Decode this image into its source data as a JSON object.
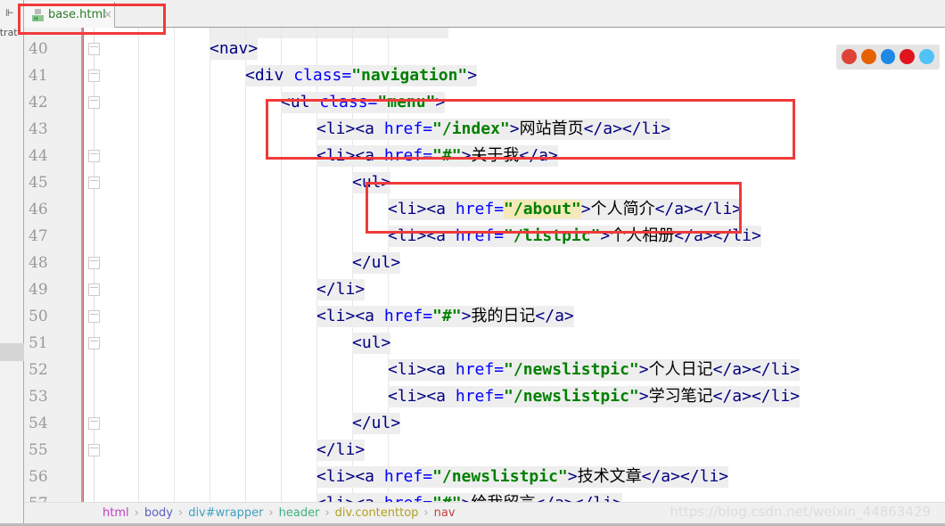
{
  "side": {
    "text": "strat"
  },
  "tab": {
    "label": "base.html",
    "close": "×"
  },
  "lines": [
    {
      "n": "40",
      "indent": 3,
      "segs": [
        [
          "t",
          "<nav>"
        ]
      ]
    },
    {
      "n": "41",
      "indent": 4,
      "segs": [
        [
          "t",
          "<div "
        ],
        [
          "a",
          "class="
        ],
        [
          "v",
          "\"navigation\""
        ],
        [
          "t",
          ">"
        ]
      ]
    },
    {
      "n": "42",
      "indent": 5,
      "segs": [
        [
          "t",
          "<ul "
        ],
        [
          "a",
          "class="
        ],
        [
          "v",
          "\"menu\""
        ],
        [
          "t",
          ">"
        ]
      ]
    },
    {
      "n": "43",
      "indent": 6,
      "segs": [
        [
          "t",
          "<li><a "
        ],
        [
          "a",
          "href="
        ],
        [
          "v",
          "\"/index\""
        ],
        [
          "t",
          ">"
        ],
        [
          "x",
          "网站首页"
        ],
        [
          "t",
          "</a></li>"
        ]
      ]
    },
    {
      "n": "44",
      "indent": 6,
      "segs": [
        [
          "t",
          "<li><a "
        ],
        [
          "a",
          "href="
        ],
        [
          "v",
          "\"#\""
        ],
        [
          "t",
          ">"
        ],
        [
          "x",
          "关于我"
        ],
        [
          "t",
          "</a>"
        ]
      ]
    },
    {
      "n": "45",
      "indent": 7,
      "segs": [
        [
          "t",
          "<ul>"
        ]
      ]
    },
    {
      "n": "46",
      "indent": 8,
      "segs": [
        [
          "t",
          "<li><a "
        ],
        [
          "a",
          "href="
        ],
        [
          "v",
          "\"/about\""
        ],
        [
          "t",
          ">"
        ],
        [
          "x",
          "个人简介"
        ],
        [
          "t",
          "</a></li>"
        ]
      ]
    },
    {
      "n": "47",
      "indent": 8,
      "segs": [
        [
          "t",
          "<li><a "
        ],
        [
          "a",
          "href="
        ],
        [
          "v",
          "\"/listpic\""
        ],
        [
          "t",
          ">"
        ],
        [
          "x",
          "个人相册"
        ],
        [
          "t",
          "</a></li>"
        ]
      ]
    },
    {
      "n": "48",
      "indent": 7,
      "segs": [
        [
          "t",
          "</ul>"
        ]
      ]
    },
    {
      "n": "49",
      "indent": 6,
      "segs": [
        [
          "t",
          "</li>"
        ]
      ]
    },
    {
      "n": "50",
      "indent": 6,
      "segs": [
        [
          "t",
          "<li><a "
        ],
        [
          "a",
          "href="
        ],
        [
          "v",
          "\"#\""
        ],
        [
          "t",
          ">"
        ],
        [
          "x",
          "我的日记"
        ],
        [
          "t",
          "</a>"
        ]
      ]
    },
    {
      "n": "51",
      "indent": 7,
      "segs": [
        [
          "t",
          "<ul>"
        ]
      ]
    },
    {
      "n": "52",
      "indent": 8,
      "segs": [
        [
          "t",
          "<li><a "
        ],
        [
          "a",
          "href="
        ],
        [
          "v",
          "\"/newslistpic\""
        ],
        [
          "t",
          ">"
        ],
        [
          "x",
          "个人日记"
        ],
        [
          "t",
          "</a></li>"
        ]
      ]
    },
    {
      "n": "53",
      "indent": 8,
      "segs": [
        [
          "t",
          "<li><a "
        ],
        [
          "a",
          "href="
        ],
        [
          "v",
          "\"/newslistpic\""
        ],
        [
          "t",
          ">"
        ],
        [
          "x",
          "学习笔记"
        ],
        [
          "t",
          "</a></li>"
        ]
      ]
    },
    {
      "n": "54",
      "indent": 7,
      "segs": [
        [
          "t",
          "</ul>"
        ]
      ]
    },
    {
      "n": "55",
      "indent": 6,
      "segs": [
        [
          "t",
          "</li>"
        ]
      ]
    },
    {
      "n": "56",
      "indent": 6,
      "segs": [
        [
          "t",
          "<li><a "
        ],
        [
          "a",
          "href="
        ],
        [
          "v",
          "\"/newslistpic\""
        ],
        [
          "t",
          ">"
        ],
        [
          "x",
          "技术文章"
        ],
        [
          "t",
          "</a></li>"
        ]
      ]
    },
    {
      "n": "57",
      "indent": 6,
      "segs": [
        [
          "t",
          "<li><a "
        ],
        [
          "a",
          "href="
        ],
        [
          "v",
          "\"#\""
        ],
        [
          "t",
          ">"
        ],
        [
          "x",
          "给我留言"
        ],
        [
          "t",
          "</a></li>"
        ]
      ]
    }
  ],
  "breadcrumb": [
    {
      "label": "html",
      "color": "#c040c0"
    },
    {
      "label": "body",
      "color": "#6060c0"
    },
    {
      "label": "div#wrapper",
      "color": "#40a0c0"
    },
    {
      "label": "header",
      "color": "#40b080"
    },
    {
      "label": "div.contenttop",
      "color": "#b0a020"
    },
    {
      "label": "nav",
      "color": "#c04040"
    }
  ],
  "breadcrumb_sep": "›",
  "watermark": "https://blog.csdn.net/weixin_44863429",
  "browsers": [
    {
      "name": "chrome-icon",
      "color": "#db4437"
    },
    {
      "name": "firefox-icon",
      "color": "#e66000"
    },
    {
      "name": "safari-icon",
      "color": "#1e88e5"
    },
    {
      "name": "opera-icon",
      "color": "#e0141e"
    },
    {
      "name": "ie-icon",
      "color": "#4fc3f7"
    }
  ]
}
